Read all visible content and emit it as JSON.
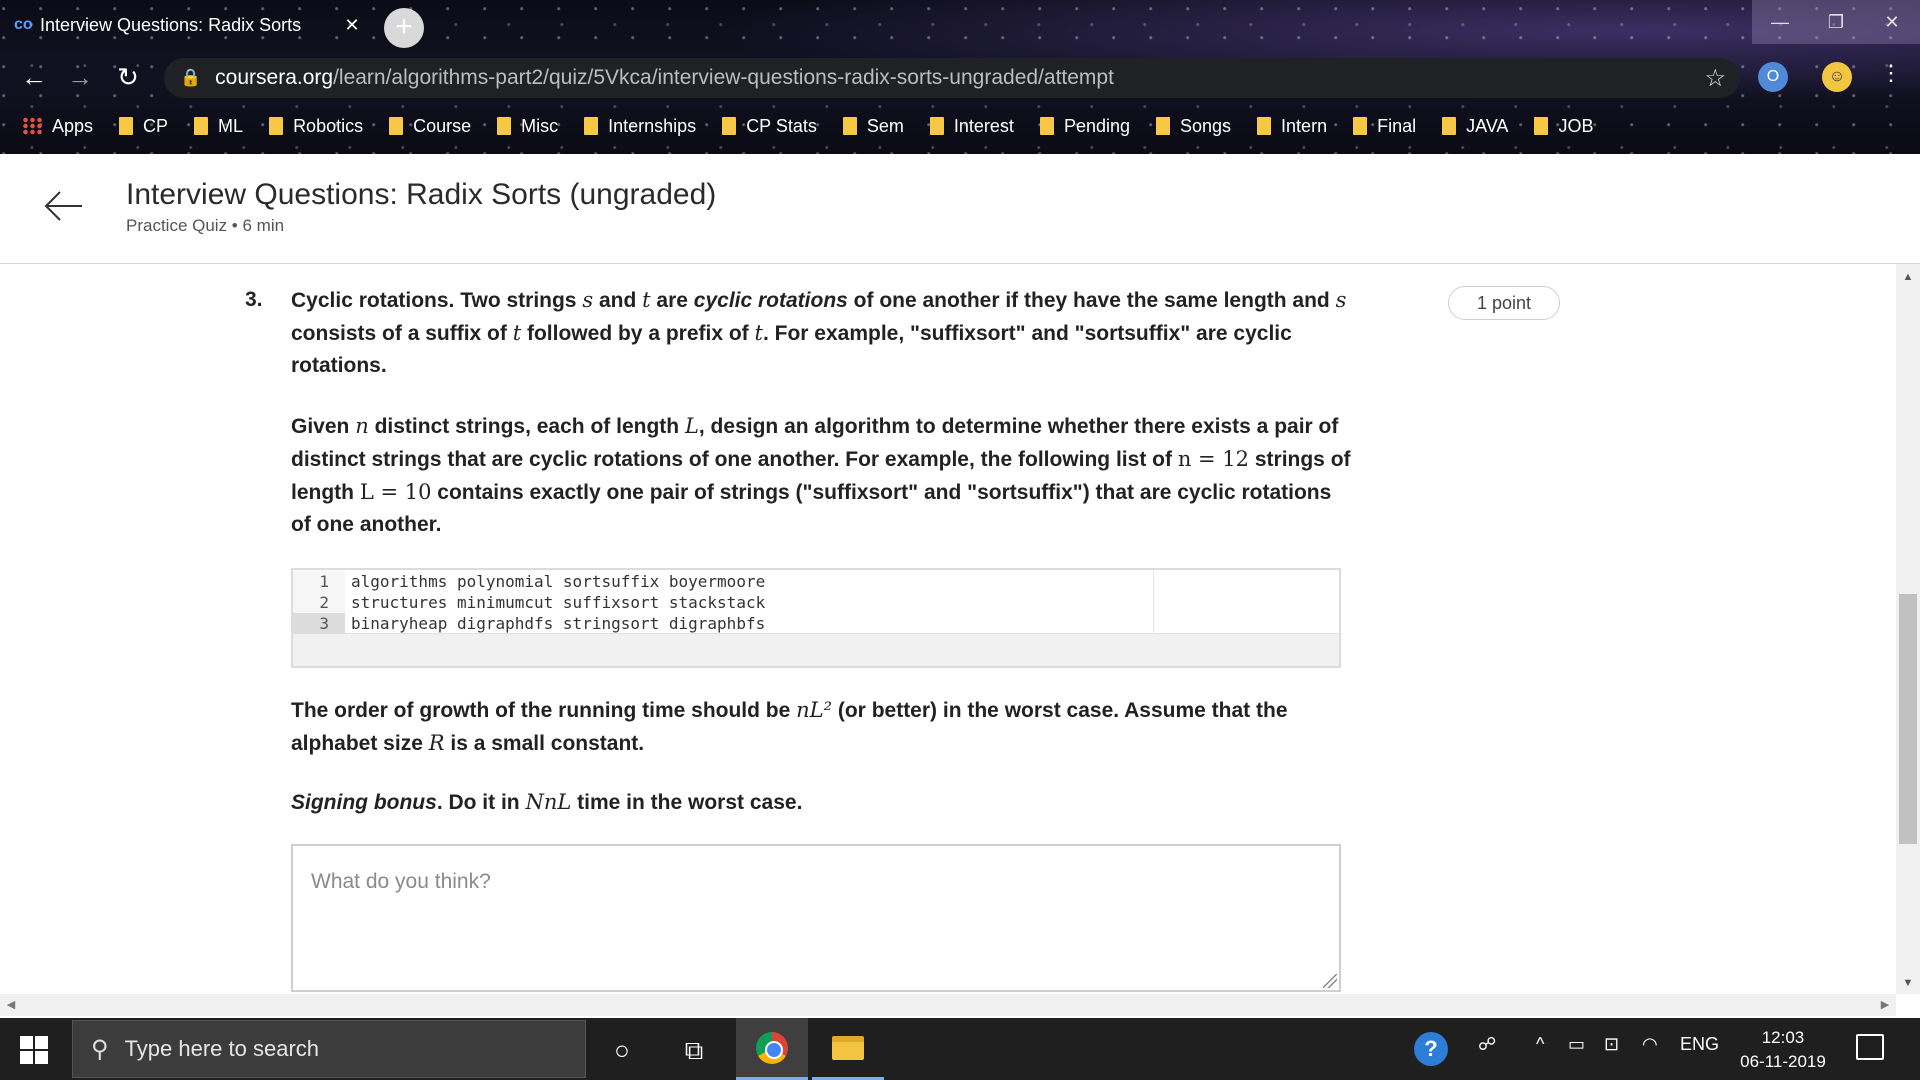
{
  "browser": {
    "tab_title": "Interview Questions: Radix Sorts",
    "tab_close": "✕",
    "new_tab": "+",
    "url_domain": "coursera.org",
    "url_path": "/learn/algorithms-part2/quiz/5Vkca/interview-questions-radix-sorts-ungraded/attempt",
    "bookmarks": [
      "Apps",
      "CP",
      "ML",
      "Robotics",
      "Course",
      "Misc",
      "Internships",
      "CP Stats",
      "Sem",
      "Interest",
      "Pending",
      "Songs",
      "Intern",
      "Final",
      "JAVA",
      "JOB"
    ]
  },
  "header": {
    "title": "Interview Questions: Radix Sorts (ungraded)",
    "meta": "Practice Quiz • 6 min"
  },
  "question": {
    "number": "3.",
    "points": "1 point",
    "p1": {
      "a": "Cyclic rotations. Two strings ",
      "s1": "s",
      "b": " and ",
      "t1": "t",
      "c": " are ",
      "em": "cyclic rotations",
      "d": " of one another if they have the same length and ",
      "s2": "s",
      "e": " consists of a suffix of ",
      "t2": "t",
      "f": " followed by a prefix of ",
      "t3": "t",
      "g": ". For example, \"suffixsort\" and \"sortsuffix\" are cyclic rotations."
    },
    "p2": {
      "a": "Given ",
      "n1": "n",
      "b": " distinct strings, each of length ",
      "L1": "L",
      "c": ", design an algorithm to determine whether there exists a pair of distinct strings that are cyclic rotations of one another. For example, the following list of ",
      "n_eq": "n = 12",
      "d": " strings of length ",
      "L_eq": "L = 10",
      "e": " contains exactly one pair of strings (\"suffixsort\" and \"sortsuffix\") that are cyclic rotations of one another."
    },
    "code_lines": [
      {
        "num": "1",
        "text": "algorithms polynomial sortsuffix boyermoore"
      },
      {
        "num": "2",
        "text": "structures minimumcut suffixsort stackstack"
      },
      {
        "num": "3",
        "text": "binaryheap digraphdfs stringsort digraphbfs"
      }
    ],
    "p3": {
      "a": "The order of growth of the running time should be ",
      "math": "nL²",
      "b": " (or better) in the worst case. Assume that the alphabet size ",
      "R": "R",
      "c": " is a small constant."
    },
    "p4": {
      "em": "Signing bonus",
      "a": ". Do it in ",
      "math": "NnL",
      "b": " time in the worst case."
    },
    "answer_placeholder": "What do you think?"
  },
  "taskbar": {
    "search_placeholder": "Type here to search",
    "language": "ENG",
    "time": "12:03",
    "date": "06-11-2019"
  }
}
